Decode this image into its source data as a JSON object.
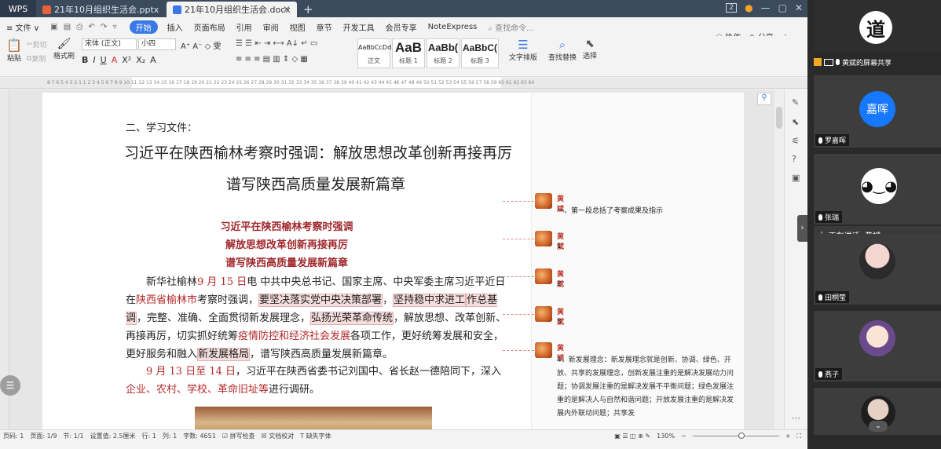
{
  "tabs": {
    "wps": "WPS",
    "pptx": "21年10月组织生活会.pptx",
    "docx": "21年10月组织生活会.docx",
    "plus": "+"
  },
  "window": {
    "badge": "2",
    "min": "—",
    "max": "▢",
    "close": "✕"
  },
  "menu": {
    "items": [
      "≡ 文件 ∨",
      "开始",
      "插入",
      "页面布局",
      "引用",
      "审阅",
      "视图",
      "章节",
      "开发工具",
      "会员专享",
      "NoteExpress"
    ],
    "search": "查找命令...",
    "right": [
      "协作",
      "分享"
    ]
  },
  "ribbon": {
    "paste": "粘贴",
    "cut": "剪切",
    "copy": "复制",
    "format_painter": "格式刷",
    "font_name": "宋体 (正文)",
    "font_size": "小四",
    "style_normal": "正文",
    "style_h1": "标题 1",
    "style_h2": "标题 2",
    "style_h3": "标题 3",
    "style_sample_normal": "AaBbCcDd",
    "style_sample_h1": "AaB",
    "style_sample_h2": "AaBb(",
    "style_sample_h3": "AaBbC(",
    "text_layout": "文字排版",
    "find_replace": "查找替换",
    "select": "选择"
  },
  "ruler": "8  7  6  5  4  3  2  1     1  2  3  4  5  6  7  8  9  10  11  12  13  14  15  16  17  18  19  20  21  22  23  24  25  26  27  28  29  30  31  32  33  34  35  36  37  38  39  40  41  42  43  44  45  46  47  48  49  50  51  52  53  54  55  56  57  58  59  60  61  62  63  64",
  "doc": {
    "section": "二、学习文件：",
    "title_line1": "习近平在陕西榆林考察时强调：解放思想改革创新再接再厉",
    "title_line2": "谱写陕西高质量发展新篇章",
    "red_line1": "习近平在陕西榆林考察时强调",
    "red_line2": "解放思想改革创新再接再厉",
    "red_line3": "谱写陕西高质量发展新篇章",
    "p1_a": "新华社榆林",
    "p1_date": "9 月 15 日",
    "p1_b": "电  中共中央总书记、国家主席、中央军委主席习近平",
    "p1_c": "近日在",
    "p1_place": "陕西省榆林市",
    "p1_d": "考察时强调，",
    "p1_e": "要坚决落实党中央决策部署",
    "p1_f": "，",
    "p1_g": "坚持稳中求进工",
    "p1_h": "作总基调",
    "p1_i": "，完整、准确、全面贯彻新发展理念，",
    "p1_j": "弘扬光荣革命传统",
    "p1_k": "，解放思想、",
    "p1_l": "改革创新、再接再厉，切实抓好统筹",
    "p1_m": "疫情防控和经济社会发展",
    "p1_n": "各项工作，更好统",
    "p1_o": "筹发展和安全，更好服务和融入",
    "p1_p": "新发展格局",
    "p1_q": "，谱写陕西高质量发展新篇章。",
    "p2_date": "9 月 13 日至 14 日",
    "p2_a": "，习近平在陕西省委书记刘国中、省长赵一德陪同下，深",
    "p2_b": "入",
    "p2_c": "企业、农村、学校、革命旧址等",
    "p2_d": "进行调研。"
  },
  "comments": [
    {
      "author": "黄斌",
      "text": "一、第一段总括了考察成果及指示"
    },
    {
      "author": "黄斌",
      "text": "1"
    },
    {
      "author": "黄斌",
      "text": "2"
    },
    {
      "author": "黄斌",
      "text": "3"
    },
    {
      "author": "黄斌",
      "text": "4：新发展理念：新发展理念就是创新、协调、绿色、开放、共享的发展理念，创新发展注重的是解决发展动力问题；协调发展注重的是解决发展不平衡问题；绿色发展注重的是解决人与自然和谐问题；开放发展注重的是解决发展内外联动问题；共享发"
    }
  ],
  "status": {
    "page": "页码: 1",
    "pages": "页面: 1/9",
    "section": "节: 1/1",
    "setting": "设置值: 2.5厘米",
    "row": "行: 1",
    "col": "列: 1",
    "words": "字数: 4651",
    "spell": "拼写检查",
    "compare": "文档校对",
    "font_missing": "缺失字体",
    "zoom": "130%"
  },
  "meeting": {
    "share_text": "黄斌的屏幕共享",
    "speaking": "正在讲话: 黄斌;",
    "participants": [
      {
        "name": "道",
        "avatar_text": "道"
      },
      {
        "name": "罗嘉晖",
        "avatar_text": "嘉晖"
      },
      {
        "name": "张瑞",
        "avatar_text": ""
      },
      {
        "name": "田桐莹",
        "avatar_text": ""
      },
      {
        "name": "燕子",
        "avatar_text": ""
      }
    ]
  },
  "colors": {
    "accent": "#3b78e7",
    "comment_red": "#c0392b",
    "doc_red": "#a0282c",
    "meet_bg": "#2a2a2a",
    "avatar_blue": "#1677ff"
  }
}
